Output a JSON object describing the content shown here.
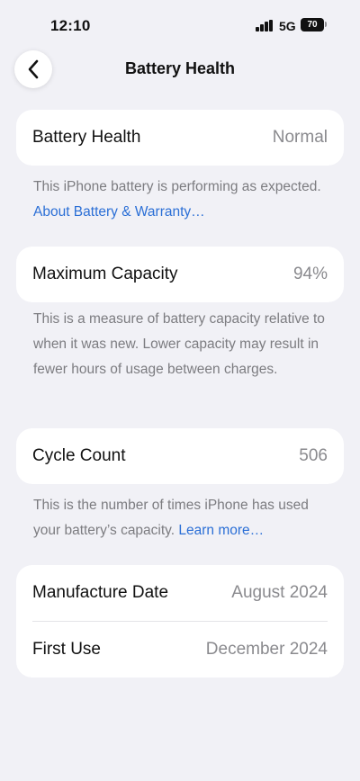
{
  "status_bar": {
    "time": "12:10",
    "network": "5G",
    "battery_level": "70"
  },
  "nav": {
    "title": "Battery Health",
    "back_icon": "chevron-left-icon"
  },
  "sections": {
    "health": {
      "label": "Battery Health",
      "value": "Normal",
      "note": "This iPhone battery is performing as expected. ",
      "link": "About Battery & Warranty…"
    },
    "capacity": {
      "label": "Maximum Capacity",
      "value": "94%",
      "note": "This is a measure of battery capacity relative to when it was new. Lower capacity may result in fewer hours of usage between charges."
    },
    "cycles": {
      "label": "Cycle Count",
      "value": "506",
      "note": "This is the number of times iPhone has used your battery’s capacity. ",
      "link": "Learn more…"
    },
    "dates": {
      "manufacture_label": "Manufacture Date",
      "manufacture_value": "August 2024",
      "first_use_label": "First Use",
      "first_use_value": "December 2024"
    }
  },
  "colors": {
    "background": "#f1f1f6",
    "card": "#ffffff",
    "link": "#2b6fd6",
    "secondary_text": "#8a8a8e"
  }
}
